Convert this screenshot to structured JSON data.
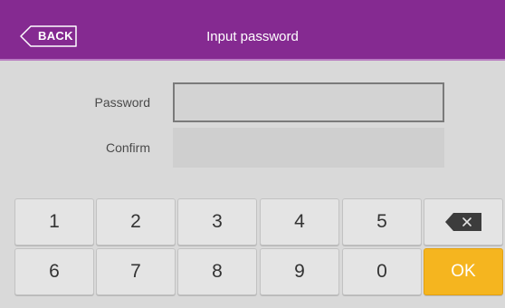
{
  "header": {
    "back_label": "BACK",
    "title": "Input password",
    "background": "#852a91"
  },
  "form": {
    "password_label": "Password",
    "password_value": "",
    "confirm_label": "Confirm",
    "confirm_value": ""
  },
  "keypad": {
    "row1": [
      "1",
      "2",
      "3",
      "4",
      "5"
    ],
    "row2": [
      "6",
      "7",
      "8",
      "9",
      "0"
    ],
    "backspace_icon": "backspace-icon",
    "ok_label": "OK",
    "ok_color": "#f5b51f"
  }
}
